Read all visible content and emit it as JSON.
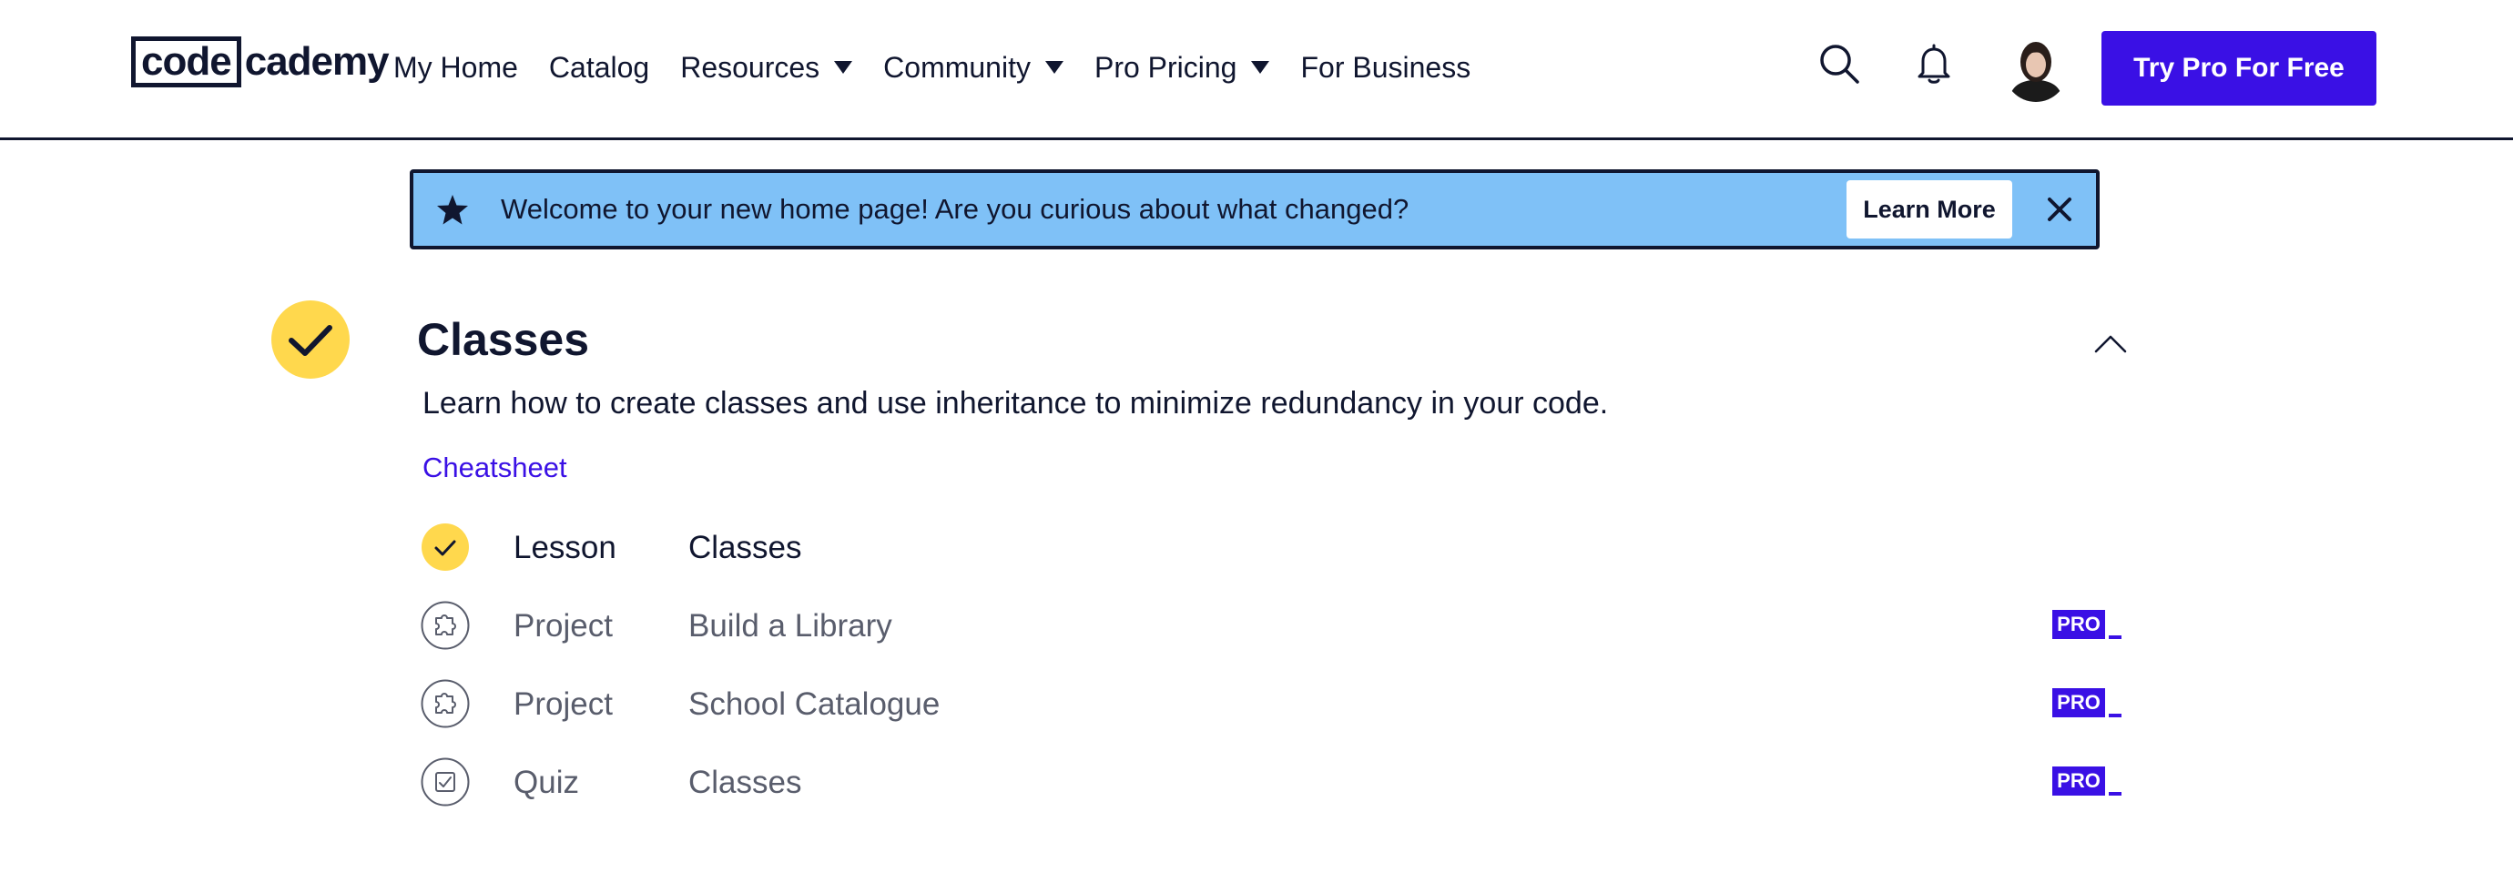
{
  "header": {
    "logo": {
      "box": "code",
      "rest": "cademy"
    },
    "nav": [
      {
        "label": "My Home",
        "dropdown": false
      },
      {
        "label": "Catalog",
        "dropdown": false
      },
      {
        "label": "Resources",
        "dropdown": true
      },
      {
        "label": "Community",
        "dropdown": true
      },
      {
        "label": "Pro Pricing",
        "dropdown": true
      },
      {
        "label": "For Business",
        "dropdown": false
      }
    ],
    "icons": [
      "search-icon",
      "bell-icon"
    ],
    "cta_label": "Try Pro For Free"
  },
  "banner": {
    "text": "Welcome to your new home page! Are you curious about what changed?",
    "button_label": "Learn More"
  },
  "section": {
    "title": "Classes",
    "description": "Learn how to create classes and use inheritance to minimize redundancy in your code.",
    "cheatsheet_label": "Cheatsheet",
    "items": [
      {
        "type": "Lesson",
        "name": "Classes",
        "status": "completed",
        "icon": "check-icon",
        "pro": ""
      },
      {
        "type": "Project",
        "name": "Build a Library",
        "status": "locked",
        "icon": "puzzle-icon",
        "pro": "PRO"
      },
      {
        "type": "Project",
        "name": "School Catalogue",
        "status": "locked",
        "icon": "puzzle-icon",
        "pro": "PRO"
      },
      {
        "type": "Quiz",
        "name": "Classes",
        "status": "locked",
        "icon": "quiz-icon",
        "pro": "PRO"
      }
    ]
  },
  "colors": {
    "brand": "#3a10e5",
    "navy": "#10162f",
    "banner_bg": "#7fc1f7",
    "complete_yellow": "#ffd84d",
    "muted_text": "#595d6c"
  }
}
